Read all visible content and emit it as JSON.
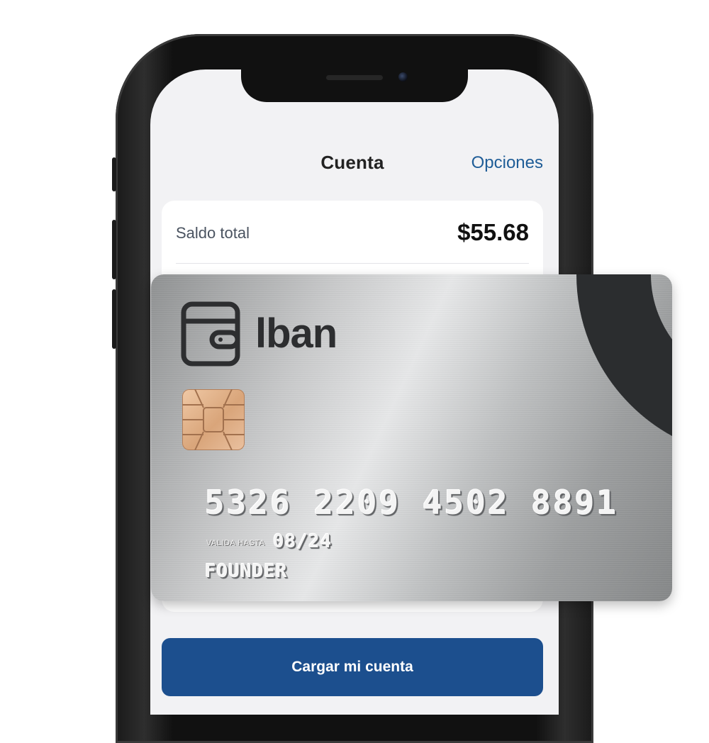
{
  "nav": {
    "title": "Cuenta",
    "options_label": "Opciones"
  },
  "balance": {
    "label": "Saldo total",
    "value": "$55.68"
  },
  "cta": {
    "label": "Cargar mi cuenta"
  },
  "card": {
    "brand": "lban",
    "logo_icon": "wallet-icon",
    "chip_icon": "emv-chip-icon",
    "number": "5326 2209 4502 8891",
    "expiry_label": "VALIDA HASTA",
    "expiry": "08/24",
    "holder": "FOUNDER"
  },
  "colors": {
    "accent": "#1f5d97",
    "button": "#1c4f8e",
    "ring": "#2b2d2f"
  }
}
